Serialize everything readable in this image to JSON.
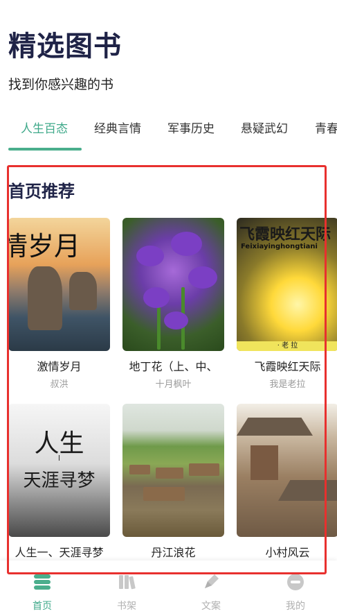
{
  "header": {
    "title": "精选图书",
    "subtitle": "找到你感兴趣的书"
  },
  "tabs": [
    {
      "label": "人生百态",
      "active": true
    },
    {
      "label": "经典言情",
      "active": false
    },
    {
      "label": "军事历史",
      "active": false
    },
    {
      "label": "悬疑武幻",
      "active": false
    },
    {
      "label": "青春",
      "active": false
    }
  ],
  "section": {
    "title": "首页推荐"
  },
  "books": [
    {
      "title": "激情岁月",
      "author": "叔洪",
      "cover_text": "情岁月"
    },
    {
      "title": "地丁花（上、中、",
      "author": "十月枫叶"
    },
    {
      "title": "飞霞映红天际",
      "author": "我是老拉",
      "cover_title": "飞霞映红天际",
      "cover_sub": "Feixiayinghongtiani",
      "cover_bottom": "· 老  拉"
    },
    {
      "title": "人生一、天涯寻梦",
      "author": "",
      "cover_line1": "人生",
      "cover_line2": "I",
      "cover_line3": "天涯寻梦"
    },
    {
      "title": "丹江浪花",
      "author": ""
    },
    {
      "title": "小村风云",
      "author": ""
    }
  ],
  "bottom_nav": [
    {
      "label": "首页",
      "icon": "home-icon",
      "active": true
    },
    {
      "label": "书架",
      "icon": "bookshelf-icon",
      "active": false
    },
    {
      "label": "文案",
      "icon": "pen-icon",
      "active": false
    },
    {
      "label": "我的",
      "icon": "profile-icon",
      "active": false
    }
  ],
  "colors": {
    "accent": "#4aae8c",
    "title": "#1f2347",
    "highlight": "#e8302e"
  }
}
